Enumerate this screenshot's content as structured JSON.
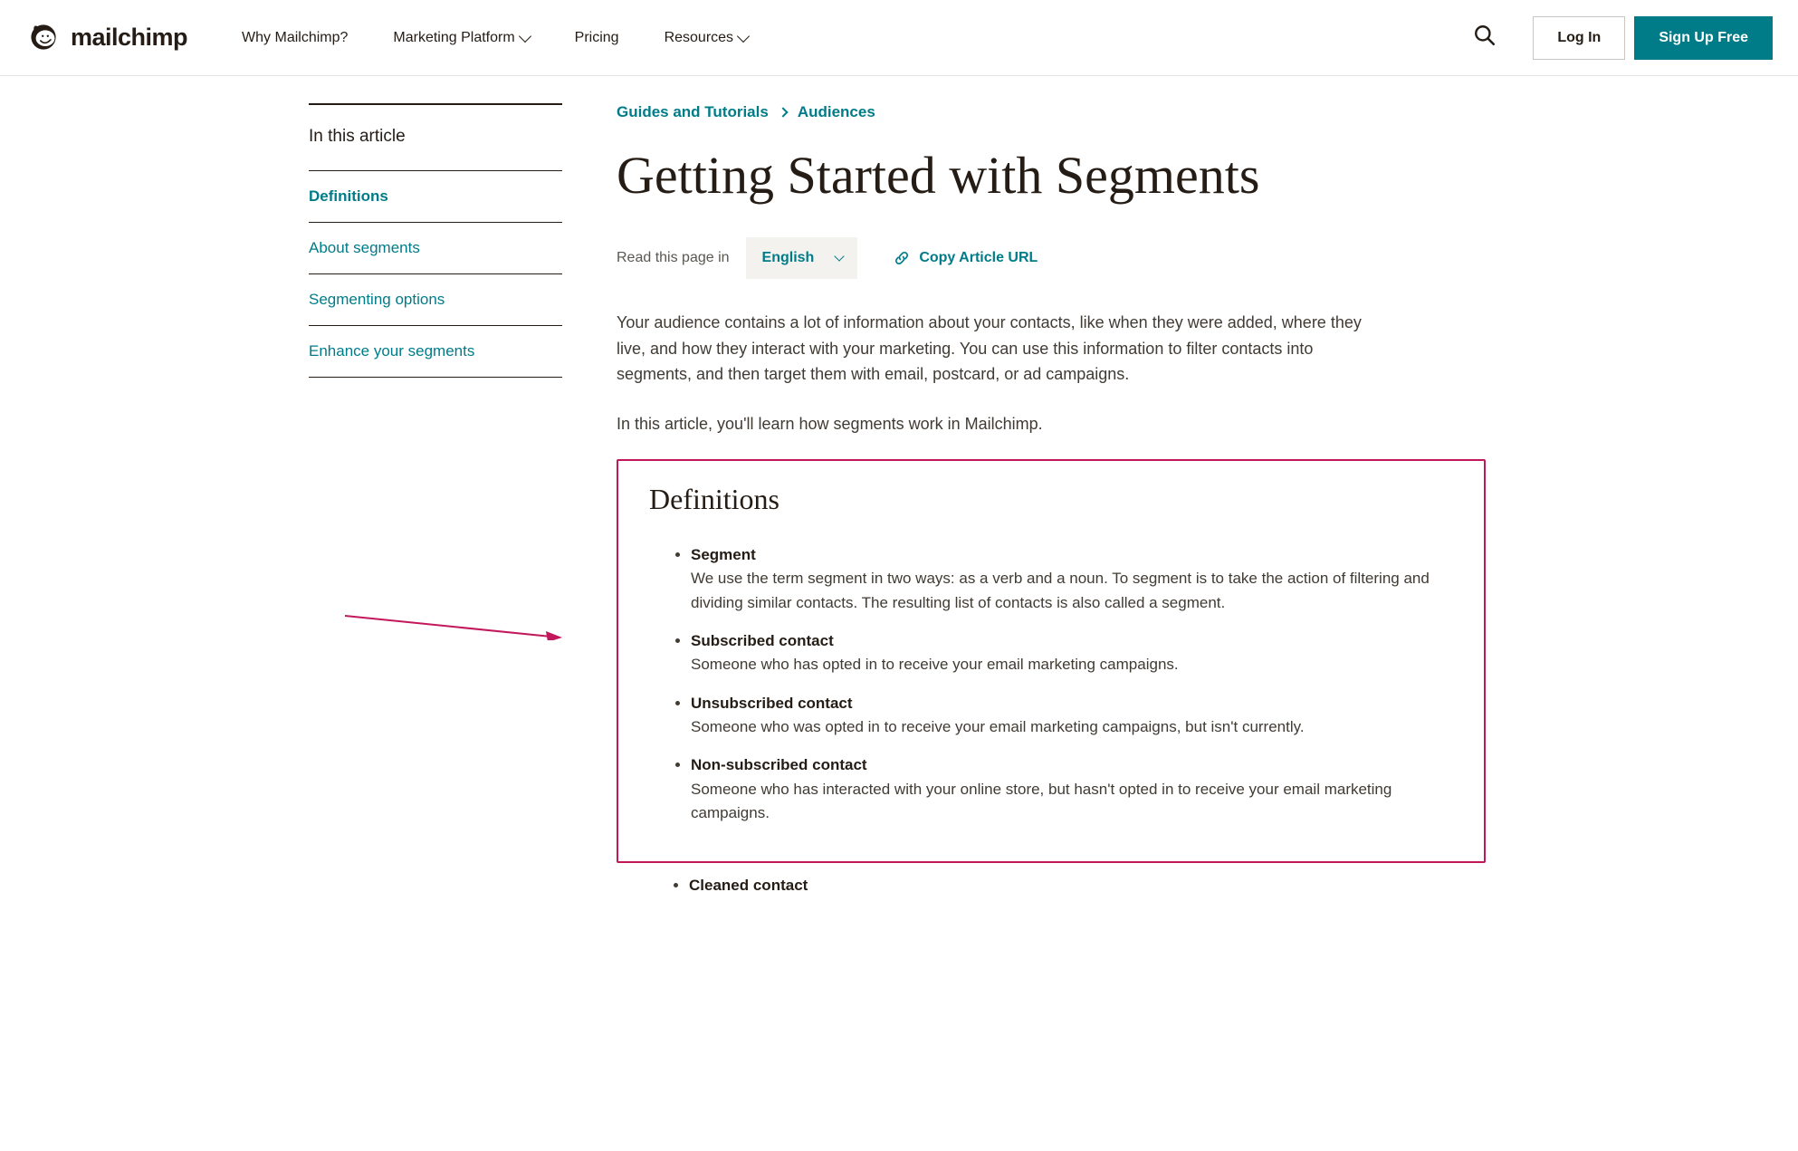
{
  "header": {
    "brand": "mailchimp",
    "nav": {
      "why": "Why Mailchimp?",
      "platform": "Marketing Platform",
      "pricing": "Pricing",
      "resources": "Resources"
    },
    "login": "Log In",
    "signup": "Sign Up Free"
  },
  "sidebar": {
    "title": "In this article",
    "items": {
      "0": "Definitions",
      "1": "About segments",
      "2": "Segmenting options",
      "3": "Enhance your segments"
    }
  },
  "breadcrumbs": {
    "0": "Guides and Tutorials",
    "1": "Audiences"
  },
  "article": {
    "title": "Getting Started with Segments",
    "read_in_label": "Read this page in",
    "language": "English",
    "copy_url": "Copy Article URL",
    "intro_p1": "Your audience contains a lot of information about your contacts, like when they were added, where they live, and how they interact with your marketing. You can use this information to filter contacts into segments, and then target them with email, postcard, or ad campaigns.",
    "intro_p2": "In this article, you'll learn how segments work in Mailchimp.",
    "definitions_heading": "Definitions",
    "defs": {
      "0": {
        "term": "Segment",
        "desc": "We use the term segment in two ways: as a verb and a noun. To segment is to take the action of filtering and dividing similar contacts. The resulting list of contacts is also called a segment."
      },
      "1": {
        "term": "Subscribed contact",
        "desc": "Someone who has opted in to receive your email marketing campaigns."
      },
      "2": {
        "term": "Unsubscribed contact",
        "desc": "Someone who was opted in to receive your email marketing campaigns, but isn't currently."
      },
      "3": {
        "term": "Non-subscribed contact",
        "desc": "Someone who has interacted with your online store, but hasn't opted in to receive your email marketing campaigns."
      },
      "4": {
        "term": "Cleaned contact",
        "desc": ""
      }
    }
  },
  "colors": {
    "teal": "#007c89",
    "highlight": "#c2185b"
  }
}
